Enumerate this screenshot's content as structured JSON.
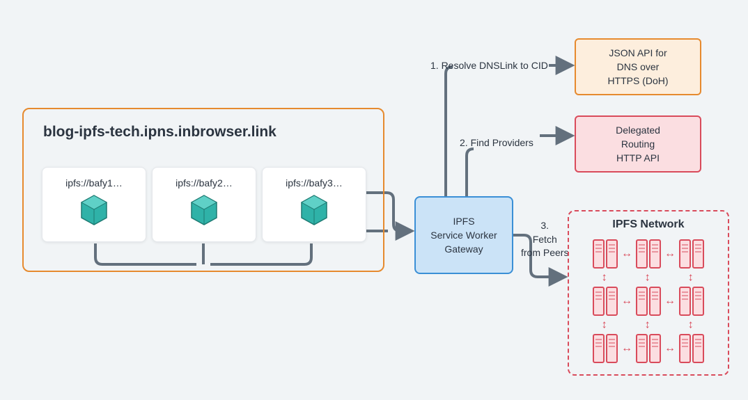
{
  "browser": {
    "title": "blog-ipfs-tech.ipns.inbrowser.link",
    "cards": [
      {
        "label": "ipfs://bafy1…"
      },
      {
        "label": "ipfs://bafy2…"
      },
      {
        "label": "ipfs://bafy3…"
      }
    ]
  },
  "gateway": {
    "line1": "IPFS",
    "line2": "Service Worker",
    "line3": "Gateway"
  },
  "steps": {
    "step1": "1.  Resolve DNSLink to CID",
    "step2": "2.  Find Providers",
    "step3_a": "3.",
    "step3_b": "Fetch",
    "step3_c": "from Peers"
  },
  "json_api": {
    "line1": "JSON API for",
    "line2": "DNS over",
    "line3": "HTTPS (DoH)"
  },
  "routing": {
    "line1": "Delegated",
    "line2": "Routing",
    "line3": "HTTP API"
  },
  "network": {
    "title": "IPFS Network"
  }
}
